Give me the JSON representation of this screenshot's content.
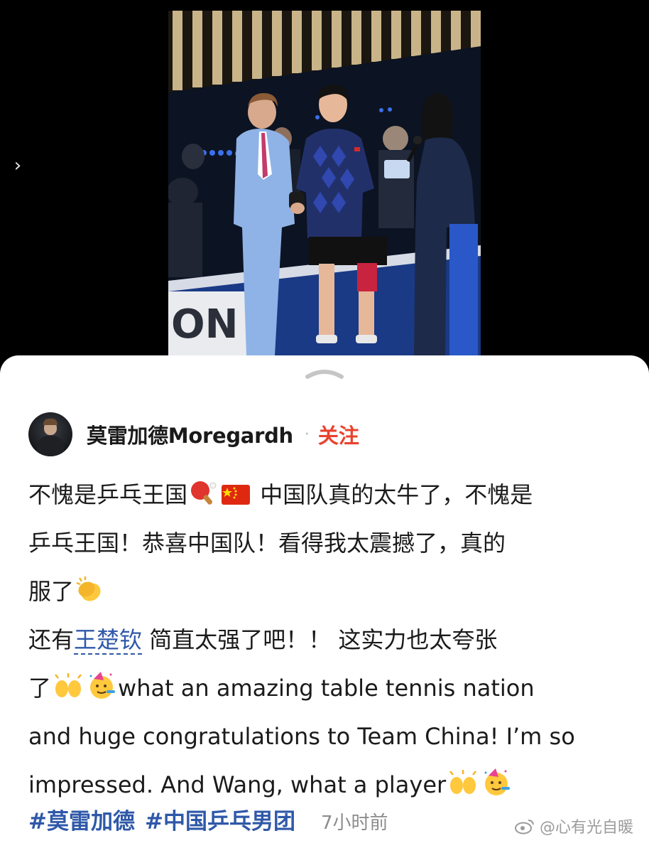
{
  "viewer": {
    "next_icon": "chevron-right-icon",
    "photo_alt": "photo"
  },
  "post": {
    "author": {
      "name": "莫雷加德Moregardh",
      "separator": "·",
      "follow_label": "关注"
    },
    "lines": {
      "l1a": "不愧是乒乓王国",
      "l1b": " 中国队真的太牛了，不愧是",
      "l2": "乒乓王国！恭喜中国队！看得我太震撼了，真的",
      "l3": "服了",
      "l4a": "还有",
      "mention": "王楚钦",
      "l4b": " 简直太强了吧！！ 这实力也太夸张",
      "l5a": "了",
      "l5b": "what an amazing table tennis nation",
      "l6": "and huge congratulations to Team China! I’m so",
      "l7": "impressed. And Wang, what a player"
    },
    "hashtags": [
      "#莫雷加德",
      "#中国乒乓男团"
    ],
    "time": "7小时前"
  },
  "watermark": {
    "text": "@心有光自暖",
    "icon": "weibo-logo-icon"
  },
  "colors": {
    "link": "#2f58a8",
    "follow": "#e8432e",
    "text": "#1b1b1b",
    "meta": "#8c8c8c"
  }
}
